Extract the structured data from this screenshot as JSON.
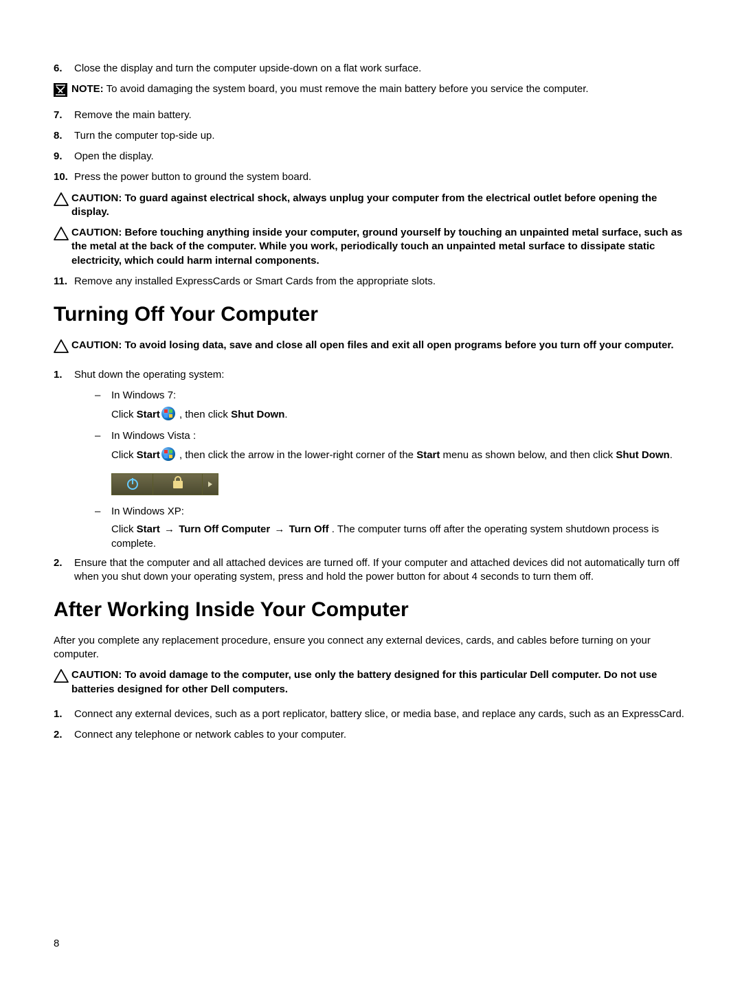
{
  "steps_a": [
    {
      "num": "6.",
      "text": "Close the display and turn the computer upside-down on a flat work surface."
    }
  ],
  "note1": {
    "prefix": "NOTE:",
    "text": " To avoid damaging the system board, you must remove the main battery before you service the computer."
  },
  "steps_b": [
    {
      "num": "7.",
      "text": "Remove the main battery."
    },
    {
      "num": "8.",
      "text": "Turn the computer top-side up."
    },
    {
      "num": "9.",
      "text": "Open the display."
    },
    {
      "num": "10.",
      "text": "Press the power button to ground the system board."
    }
  ],
  "caution1": {
    "prefix": "CAUTION: ",
    "text": "To guard against electrical shock, always unplug your computer from the electrical outlet before opening the display."
  },
  "caution2": {
    "prefix": "CAUTION: ",
    "text": "Before touching anything inside your computer, ground yourself by touching an unpainted metal surface, such as the metal at the back of the computer. While you work, periodically touch an unpainted metal surface to dissipate static electricity, which could harm internal components."
  },
  "steps_c": [
    {
      "num": "11.",
      "text": "Remove any installed ExpressCards or Smart Cards from the appropriate slots."
    }
  ],
  "h2_1": "Turning Off Your Computer",
  "caution3": {
    "prefix": "CAUTION: ",
    "text": "To avoid losing data, save and close all open files and exit all open programs before you turn off your computer."
  },
  "turn_off": {
    "step1_num": "1.",
    "step1_text": "Shut down the operating system:",
    "win7_label": "In Windows 7:",
    "win7_click": "Click ",
    "win7_start": "Start",
    "win7_click2": " , then click ",
    "win7_shut": "Shut Down",
    "win7_period": ".",
    "vista_label": "In Windows Vista :",
    "vista_click": "Click ",
    "vista_start": "Start",
    "vista_rest": " , then click the arrow in the lower-right corner of the ",
    "vista_start2": "Start",
    "vista_rest2": " menu as shown below, and then click ",
    "vista_shut": "Shut Down",
    "vista_period": ".",
    "xp_label": "In Windows XP:",
    "xp_click": "Click ",
    "xp_start": "Start",
    "xp_arrow": " → ",
    "xp_turn_comp": "Turn Off Computer",
    "xp_turn_off": "Turn Off",
    "xp_rest": " . The computer turns off after the operating system shutdown process is complete.",
    "step2_num": "2.",
    "step2_text": "Ensure that the computer and all attached devices are turned off. If your computer and attached devices did not automatically turn off when you shut down your operating system, press and hold the power button for about 4 seconds to turn them off."
  },
  "h2_2": "After Working Inside Your Computer",
  "after_para": "After you complete any replacement procedure, ensure you connect any external devices, cards, and cables before turning on your computer.",
  "caution4": {
    "prefix": "CAUTION: ",
    "text": "To avoid damage to the computer, use only the battery designed for this particular Dell computer. Do not use batteries designed for other Dell computers."
  },
  "after_steps": [
    {
      "num": "1.",
      "text": "Connect any external devices, such as a port replicator, battery slice, or media base, and replace any cards, such as an ExpressCard."
    },
    {
      "num": "2.",
      "text": "Connect any telephone or network cables to your computer."
    }
  ],
  "page_number": "8"
}
